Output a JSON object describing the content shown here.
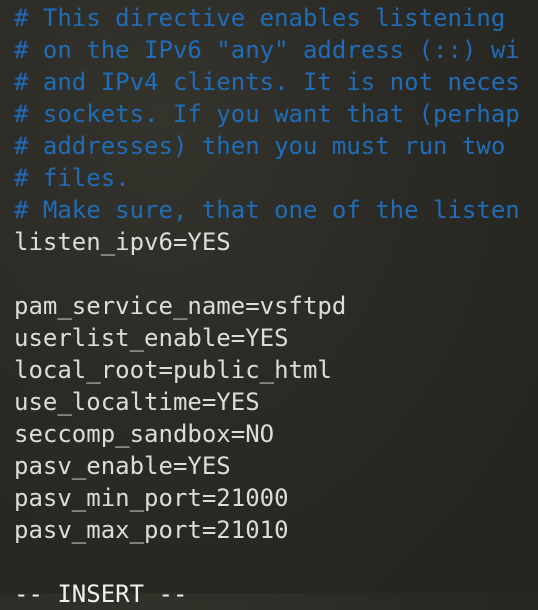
{
  "editor": {
    "lines": [
      {
        "text": "# This directive enables listening",
        "type": "comment"
      },
      {
        "text": "# on the IPv6 \"any\" address (::) wi",
        "type": "comment"
      },
      {
        "text": "# and IPv4 clients. It is not neces",
        "type": "comment"
      },
      {
        "text": "# sockets. If you want that (perhap",
        "type": "comment"
      },
      {
        "text": "# addresses) then you must run two",
        "type": "comment"
      },
      {
        "text": "# files.",
        "type": "comment"
      },
      {
        "text": "# Make sure, that one of the listen",
        "type": "comment"
      },
      {
        "text": "listen_ipv6=YES",
        "type": "code"
      },
      {
        "text": "",
        "type": "code"
      },
      {
        "text": "pam_service_name=vsftpd",
        "type": "code"
      },
      {
        "text": "userlist_enable=YES",
        "type": "code"
      },
      {
        "text": "local_root=public_html",
        "type": "code"
      },
      {
        "text": "use_localtime=YES",
        "type": "code"
      },
      {
        "text": "seccomp_sandbox=NO",
        "type": "code"
      },
      {
        "text": "pasv_enable=YES",
        "type": "code"
      },
      {
        "text": "pasv_min_port=21000",
        "type": "code"
      },
      {
        "text": "pasv_max_port=21010",
        "type": "code"
      }
    ],
    "mode": "-- INSERT --"
  },
  "colors": {
    "comment": "#1f6db8",
    "text": "#dcdcdc"
  }
}
